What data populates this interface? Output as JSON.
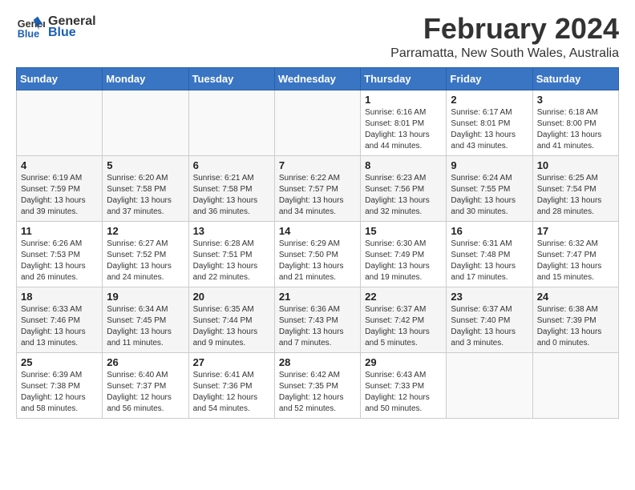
{
  "header": {
    "logo_general": "General",
    "logo_blue": "Blue",
    "main_title": "February 2024",
    "subtitle": "Parramatta, New South Wales, Australia"
  },
  "days_of_week": [
    "Sunday",
    "Monday",
    "Tuesday",
    "Wednesday",
    "Thursday",
    "Friday",
    "Saturday"
  ],
  "weeks": [
    [
      {
        "num": "",
        "detail": ""
      },
      {
        "num": "",
        "detail": ""
      },
      {
        "num": "",
        "detail": ""
      },
      {
        "num": "",
        "detail": ""
      },
      {
        "num": "1",
        "detail": "Sunrise: 6:16 AM\nSunset: 8:01 PM\nDaylight: 13 hours\nand 44 minutes."
      },
      {
        "num": "2",
        "detail": "Sunrise: 6:17 AM\nSunset: 8:01 PM\nDaylight: 13 hours\nand 43 minutes."
      },
      {
        "num": "3",
        "detail": "Sunrise: 6:18 AM\nSunset: 8:00 PM\nDaylight: 13 hours\nand 41 minutes."
      }
    ],
    [
      {
        "num": "4",
        "detail": "Sunrise: 6:19 AM\nSunset: 7:59 PM\nDaylight: 13 hours\nand 39 minutes."
      },
      {
        "num": "5",
        "detail": "Sunrise: 6:20 AM\nSunset: 7:58 PM\nDaylight: 13 hours\nand 37 minutes."
      },
      {
        "num": "6",
        "detail": "Sunrise: 6:21 AM\nSunset: 7:58 PM\nDaylight: 13 hours\nand 36 minutes."
      },
      {
        "num": "7",
        "detail": "Sunrise: 6:22 AM\nSunset: 7:57 PM\nDaylight: 13 hours\nand 34 minutes."
      },
      {
        "num": "8",
        "detail": "Sunrise: 6:23 AM\nSunset: 7:56 PM\nDaylight: 13 hours\nand 32 minutes."
      },
      {
        "num": "9",
        "detail": "Sunrise: 6:24 AM\nSunset: 7:55 PM\nDaylight: 13 hours\nand 30 minutes."
      },
      {
        "num": "10",
        "detail": "Sunrise: 6:25 AM\nSunset: 7:54 PM\nDaylight: 13 hours\nand 28 minutes."
      }
    ],
    [
      {
        "num": "11",
        "detail": "Sunrise: 6:26 AM\nSunset: 7:53 PM\nDaylight: 13 hours\nand 26 minutes."
      },
      {
        "num": "12",
        "detail": "Sunrise: 6:27 AM\nSunset: 7:52 PM\nDaylight: 13 hours\nand 24 minutes."
      },
      {
        "num": "13",
        "detail": "Sunrise: 6:28 AM\nSunset: 7:51 PM\nDaylight: 13 hours\nand 22 minutes."
      },
      {
        "num": "14",
        "detail": "Sunrise: 6:29 AM\nSunset: 7:50 PM\nDaylight: 13 hours\nand 21 minutes."
      },
      {
        "num": "15",
        "detail": "Sunrise: 6:30 AM\nSunset: 7:49 PM\nDaylight: 13 hours\nand 19 minutes."
      },
      {
        "num": "16",
        "detail": "Sunrise: 6:31 AM\nSunset: 7:48 PM\nDaylight: 13 hours\nand 17 minutes."
      },
      {
        "num": "17",
        "detail": "Sunrise: 6:32 AM\nSunset: 7:47 PM\nDaylight: 13 hours\nand 15 minutes."
      }
    ],
    [
      {
        "num": "18",
        "detail": "Sunrise: 6:33 AM\nSunset: 7:46 PM\nDaylight: 13 hours\nand 13 minutes."
      },
      {
        "num": "19",
        "detail": "Sunrise: 6:34 AM\nSunset: 7:45 PM\nDaylight: 13 hours\nand 11 minutes."
      },
      {
        "num": "20",
        "detail": "Sunrise: 6:35 AM\nSunset: 7:44 PM\nDaylight: 13 hours\nand 9 minutes."
      },
      {
        "num": "21",
        "detail": "Sunrise: 6:36 AM\nSunset: 7:43 PM\nDaylight: 13 hours\nand 7 minutes."
      },
      {
        "num": "22",
        "detail": "Sunrise: 6:37 AM\nSunset: 7:42 PM\nDaylight: 13 hours\nand 5 minutes."
      },
      {
        "num": "23",
        "detail": "Sunrise: 6:37 AM\nSunset: 7:40 PM\nDaylight: 13 hours\nand 3 minutes."
      },
      {
        "num": "24",
        "detail": "Sunrise: 6:38 AM\nSunset: 7:39 PM\nDaylight: 13 hours\nand 0 minutes."
      }
    ],
    [
      {
        "num": "25",
        "detail": "Sunrise: 6:39 AM\nSunset: 7:38 PM\nDaylight: 12 hours\nand 58 minutes."
      },
      {
        "num": "26",
        "detail": "Sunrise: 6:40 AM\nSunset: 7:37 PM\nDaylight: 12 hours\nand 56 minutes."
      },
      {
        "num": "27",
        "detail": "Sunrise: 6:41 AM\nSunset: 7:36 PM\nDaylight: 12 hours\nand 54 minutes."
      },
      {
        "num": "28",
        "detail": "Sunrise: 6:42 AM\nSunset: 7:35 PM\nDaylight: 12 hours\nand 52 minutes."
      },
      {
        "num": "29",
        "detail": "Sunrise: 6:43 AM\nSunset: 7:33 PM\nDaylight: 12 hours\nand 50 minutes."
      },
      {
        "num": "",
        "detail": ""
      },
      {
        "num": "",
        "detail": ""
      }
    ]
  ]
}
